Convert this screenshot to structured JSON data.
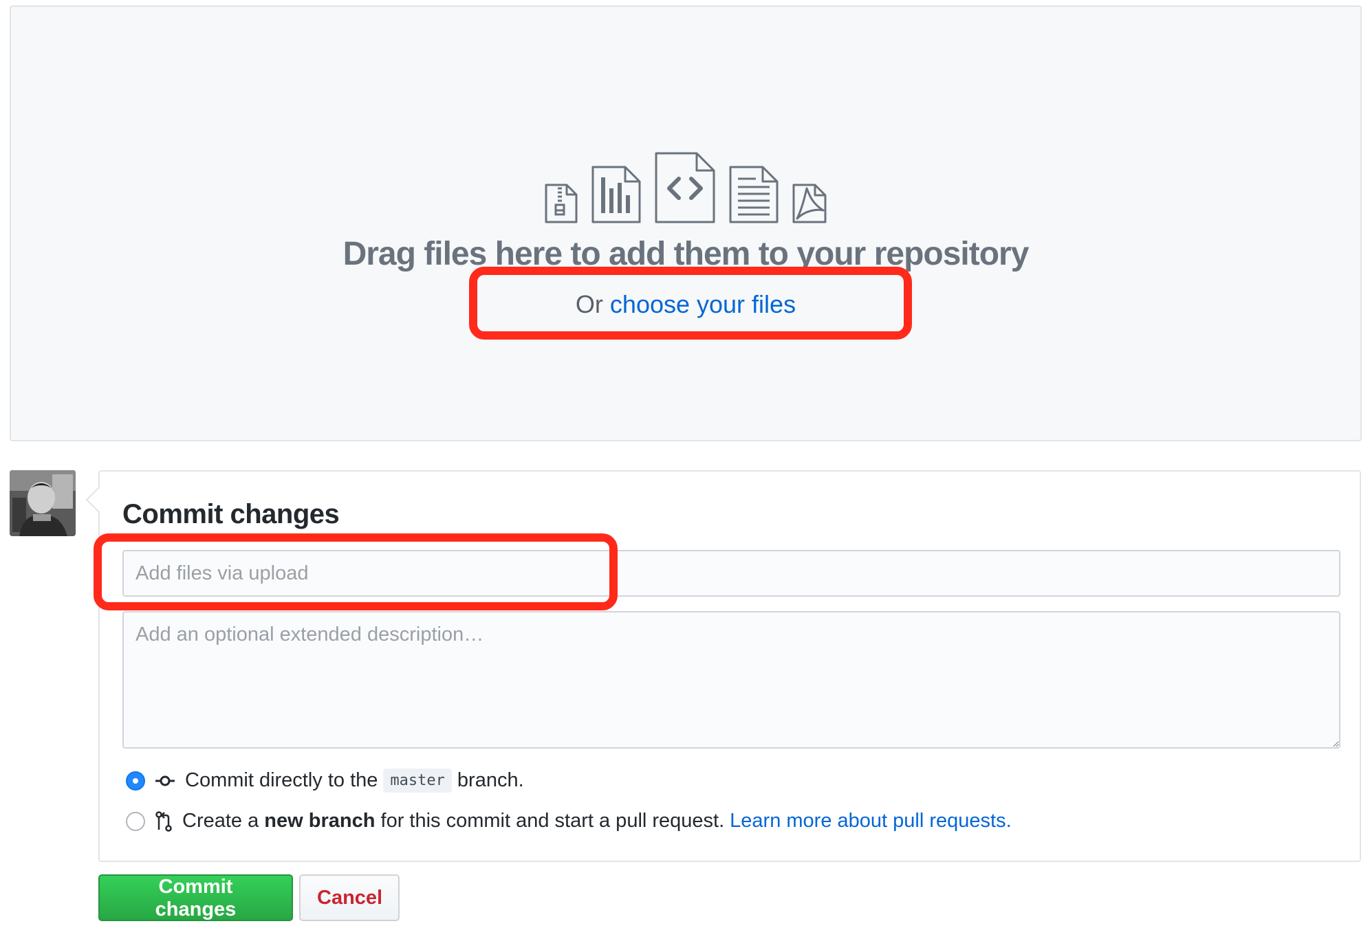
{
  "dropzone": {
    "icons": [
      "file-zip-icon",
      "graph-icon",
      "file-code-icon",
      "file-text-icon",
      "file-pdf-icon"
    ],
    "title": "Drag files here to add them to your repository",
    "choose_prefix": "Or ",
    "choose_link": "choose your files"
  },
  "commit": {
    "heading": "Commit changes",
    "summary_placeholder": "Add files via upload",
    "summary_value": "",
    "description_placeholder": "Add an optional extended description…",
    "description_value": "",
    "option_direct": {
      "checked": true,
      "text_before": "Commit directly to the",
      "branch": "master",
      "text_after": "branch."
    },
    "option_branch": {
      "checked": false,
      "text_before": "Create a",
      "bold": "new branch",
      "text_after": "for this commit and start a pull request.",
      "link": "Learn more about pull requests."
    }
  },
  "buttons": {
    "commit": "Commit changes",
    "cancel": "Cancel"
  },
  "colors": {
    "accent_blue": "#0366d6",
    "commit_green": "#28a745",
    "cancel_red": "#cb2431",
    "highlight_red": "#ff2a1a"
  }
}
